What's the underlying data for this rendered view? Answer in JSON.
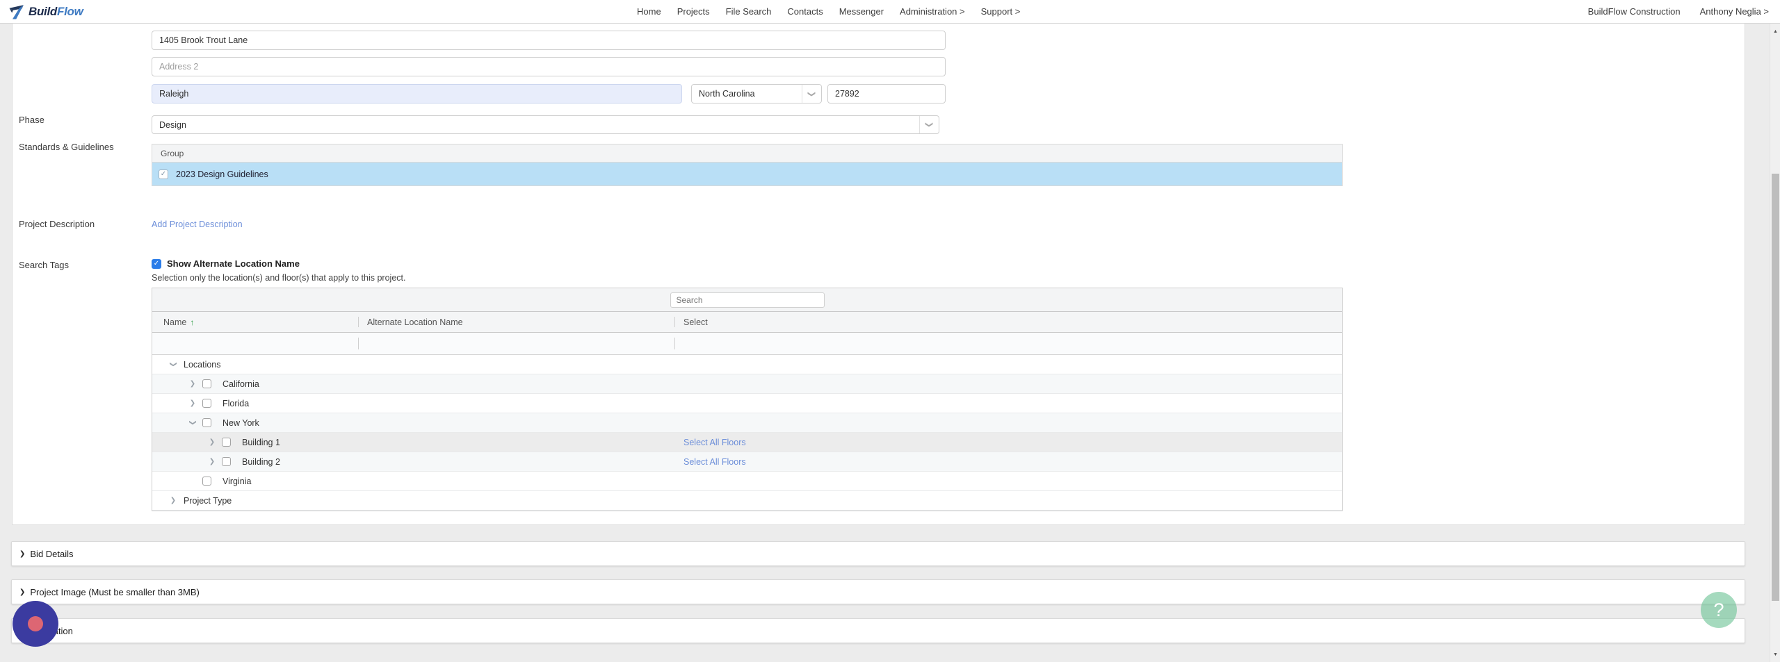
{
  "nav": {
    "brand": {
      "build": "Build",
      "flow": "Flow"
    },
    "items": [
      "Home",
      "Projects",
      "File Search",
      "Contacts",
      "Messenger",
      "Administration >",
      "Support >"
    ],
    "company": "BuildFlow Construction",
    "user": "Anthony Neglia >"
  },
  "form": {
    "address1": {
      "value": "1405 Brook Trout Lane"
    },
    "address2": {
      "placeholder": "Address 2"
    },
    "city": {
      "value": "Raleigh"
    },
    "state": {
      "value": "North Carolina"
    },
    "zip": {
      "value": "27892"
    },
    "phase": {
      "label": "Phase",
      "value": "Design"
    },
    "standards": {
      "label": "Standards & Guidelines",
      "column": "Group",
      "rows": [
        {
          "label": "2023 Design Guidelines",
          "checked": true
        }
      ]
    },
    "description": {
      "label": "Project Description",
      "link": "Add Project Description"
    },
    "search_tags": {
      "label": "Search Tags",
      "toggle": "Show Alternate Location Name",
      "toggle_checked": true,
      "hint": "Selection only the location(s) and floor(s) that apply to this project.",
      "search_placeholder": "Search",
      "columns": [
        "Name",
        "Alternate Location Name",
        "Select"
      ],
      "sort_column": "Name",
      "sort_direction": "ascending",
      "rows": [
        {
          "name": "Locations",
          "level": 0,
          "expander": "down",
          "checkbox": false,
          "checked": false,
          "link": "",
          "shade": ""
        },
        {
          "name": "California",
          "level": 1,
          "expander": "right",
          "checkbox": true,
          "checked": false,
          "link": "",
          "shade": "tint"
        },
        {
          "name": "Florida",
          "level": 1,
          "expander": "right",
          "checkbox": true,
          "checked": false,
          "link": "",
          "shade": ""
        },
        {
          "name": "New York",
          "level": 1,
          "expander": "down",
          "checkbox": true,
          "checked": false,
          "link": "",
          "shade": "tint"
        },
        {
          "name": "Building 1",
          "level": 2,
          "expander": "right",
          "checkbox": true,
          "checked": false,
          "link": "Select All Floors",
          "shade": "hover"
        },
        {
          "name": "Building 2",
          "level": 2,
          "expander": "right",
          "checkbox": true,
          "checked": false,
          "link": "Select All Floors",
          "shade": "tint"
        },
        {
          "name": "Virginia",
          "level": 1,
          "expander": "",
          "checkbox": true,
          "checked": false,
          "link": "",
          "shade": ""
        },
        {
          "name": "Project Type",
          "level": 0,
          "expander": "right",
          "checkbox": false,
          "checked": false,
          "link": "",
          "shade": ""
        }
      ]
    }
  },
  "sections": [
    {
      "label": "Bid Details"
    },
    {
      "label": "Project Image (Must be smaller than 3MB)"
    },
    {
      "label": "Integration"
    }
  ],
  "help_button": "?",
  "icons": {
    "expander_collapsed": "chevron-right",
    "expander_expanded": "chevron-down",
    "select_dropdown": "chevron-down",
    "sort": "arrow-up",
    "help": "question-mark",
    "scroll_up": "▲",
    "scroll_down": "▼"
  },
  "colors": {
    "accent_blue": "#2b7de9",
    "link_blue": "#6c8ed9",
    "highlight_row": "#b9dff6",
    "autofill_bg": "#e8edfb",
    "sort_green": "#2e9e44",
    "indicator_purple": "#3b3ba0",
    "indicator_pink": "#dd6673",
    "help_green": "#6ec396",
    "brand_navy": "#1e2c4c",
    "brand_blue": "#3e7ac2"
  }
}
